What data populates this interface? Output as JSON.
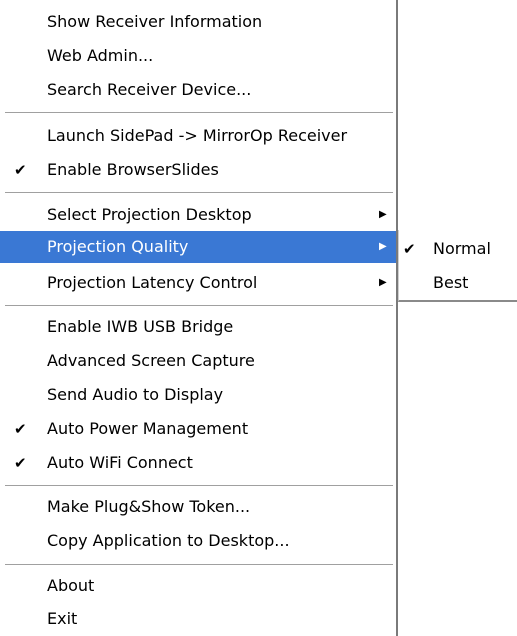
{
  "menu": {
    "items": [
      {
        "label": "Show Receiver Information"
      },
      {
        "label": "Web Admin..."
      },
      {
        "label": "Search Receiver Device..."
      },
      {
        "label": "Launch SidePad -> MirrorOp Receiver"
      },
      {
        "label": "Enable BrowserSlides",
        "checked": true
      },
      {
        "label": "Select Projection Desktop",
        "submenu": true
      },
      {
        "label": "Projection Quality",
        "submenu": true,
        "highlighted": true
      },
      {
        "label": "Projection Latency Control",
        "submenu": true
      },
      {
        "label": "Enable IWB USB Bridge"
      },
      {
        "label": "Advanced Screen Capture"
      },
      {
        "label": "Send Audio to Display"
      },
      {
        "label": "Auto Power Management",
        "checked": true
      },
      {
        "label": "Auto WiFi Connect",
        "checked": true
      },
      {
        "label": "Make Plug&Show Token..."
      },
      {
        "label": "Copy Application to Desktop..."
      },
      {
        "label": "About"
      },
      {
        "label": "Exit"
      }
    ],
    "check_glyph": "✔",
    "arrow_glyph": "▶",
    "highlight_color": "#3a78d4"
  },
  "submenu": {
    "items": [
      {
        "label": "Normal",
        "checked": true
      },
      {
        "label": "Best"
      }
    ]
  }
}
